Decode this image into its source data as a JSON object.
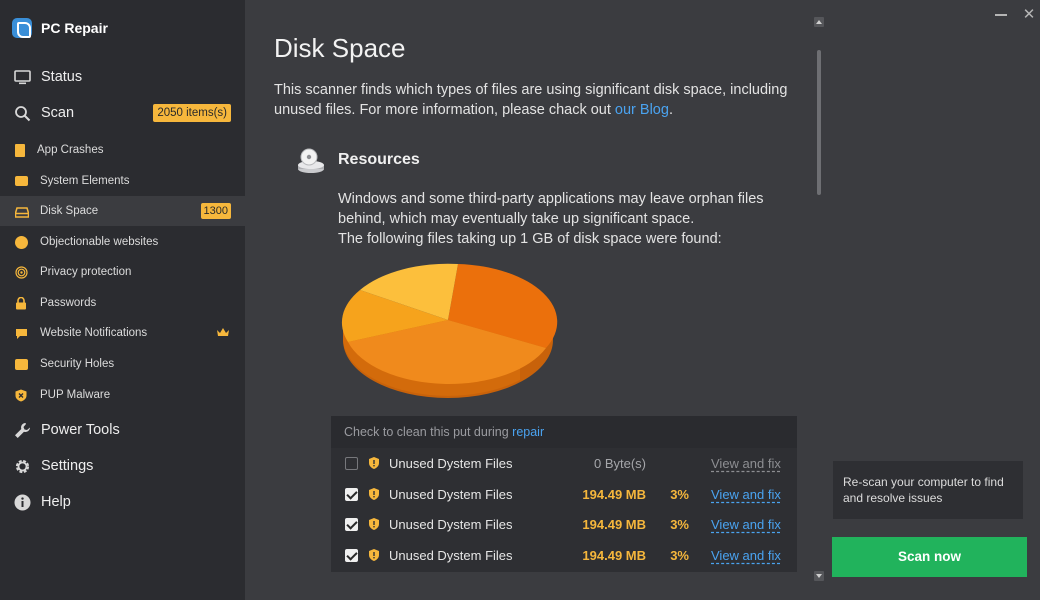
{
  "app": {
    "title": "PC Repair"
  },
  "sidebar": {
    "status_label": "Status",
    "scan_label": "Scan",
    "scan_badge": "2050 items(s)",
    "items": [
      {
        "label": "App Crashes",
        "icon": "app-crashes-icon"
      },
      {
        "label": "System Elements",
        "icon": "system-elements-icon"
      },
      {
        "label": "Disk Space",
        "icon": "disk-icon",
        "badge": "1300"
      },
      {
        "label": "Objectionable websites",
        "icon": "globe-icon"
      },
      {
        "label": "Privacy protection",
        "icon": "fingerprint-icon"
      },
      {
        "label": "Passwords",
        "icon": "lock-icon"
      },
      {
        "label": "Website Notifications",
        "icon": "chat-icon"
      },
      {
        "label": "Security Holes",
        "icon": "security-holes-icon"
      },
      {
        "label": "PUP Malware",
        "icon": "shield-x-icon"
      }
    ],
    "power_tools_label": "Power Tools",
    "settings_label": "Settings",
    "help_label": "Help"
  },
  "main": {
    "title": "Disk Space",
    "intro_text": "This scanner finds which types of files are using significant disk space, including unused files. For more information, please chack out ",
    "intro_link": "our Blog",
    "intro_end": ".",
    "resources_title": "Resources",
    "resources_line1": "Windows and some third-party applications may leave orphan files behind, which may eventually take up significant space.",
    "resources_line2": "The following files taking up 1 GB of disk space were found:",
    "pie_colors": [
      "#f08a1c",
      "#eb700c",
      "#f6a31c",
      "#fcbf3c"
    ],
    "table": {
      "header_text": "Check to clean this put during ",
      "header_link": "repair",
      "rows": [
        {
          "name": "Unused Dystem Files",
          "size": "0  Byte(s)",
          "pct": "",
          "action": "View and fix",
          "checked": false
        },
        {
          "name": "Unused Dystem Files",
          "size": "194.49 MB",
          "pct": "3%",
          "action": "View and fix",
          "checked": true
        },
        {
          "name": "Unused Dystem Files",
          "size": "194.49 MB",
          "pct": "3%",
          "action": "View and fix",
          "checked": true
        },
        {
          "name": "Unused Dystem Files",
          "size": "194.49 MB",
          "pct": "3%",
          "action": "View and fix",
          "checked": true
        }
      ]
    }
  },
  "right_panel": {
    "rescan_text": "Re-scan your computer to find and resolve issues",
    "scan_button": "Scan now"
  },
  "colors": {
    "accent": "#f6b73c",
    "link": "#4aa3f0",
    "button": "#21b35c"
  }
}
